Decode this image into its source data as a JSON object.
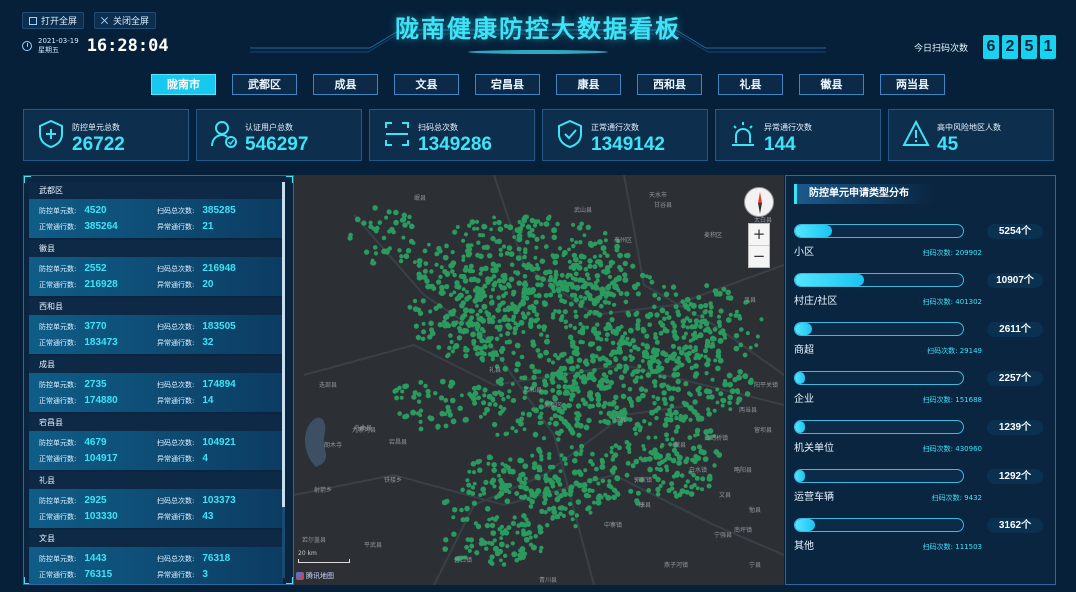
{
  "header": {
    "open_fullscreen": "打开全屏",
    "close_fullscreen": "关闭全屏",
    "date": "2021-03-19",
    "weekday": "星期五",
    "time": "16:28:04",
    "title": "陇南健康防控大数据看板",
    "scan_today_label": "今日扫码次数",
    "scan_today_digits": [
      "6",
      "2",
      "5",
      "1"
    ]
  },
  "tabs": [
    "陇南市",
    "武都区",
    "成县",
    "文县",
    "宕昌县",
    "康县",
    "西和县",
    "礼县",
    "徽县",
    "两当县"
  ],
  "stats": [
    {
      "label": "防控单元总数",
      "value": "26722",
      "icon": "shield-plus-icon"
    },
    {
      "label": "认证用户总数",
      "value": "546297",
      "icon": "user-check-icon"
    },
    {
      "label": "扫码总次数",
      "value": "1349286",
      "icon": "scan-icon"
    },
    {
      "label": "正常通行次数",
      "value": "1349142",
      "icon": "shield-check-icon"
    },
    {
      "label": "异常通行次数",
      "value": "144",
      "icon": "alarm-light-icon"
    },
    {
      "label": "高中风险地区人数",
      "value": "45",
      "icon": "warning-icon"
    }
  ],
  "region_labels": {
    "units": "防控单元数:",
    "scans": "扫码总次数:",
    "normal": "正常通行数:",
    "abnormal": "异常通行数:"
  },
  "regions": [
    {
      "name": "武都区",
      "units": "4520",
      "scans": "385285",
      "normal": "385264",
      "abnormal": "21"
    },
    {
      "name": "徽县",
      "units": "2552",
      "scans": "216948",
      "normal": "216928",
      "abnormal": "20"
    },
    {
      "name": "西和县",
      "units": "3770",
      "scans": "183505",
      "normal": "183473",
      "abnormal": "32"
    },
    {
      "name": "成县",
      "units": "2735",
      "scans": "174894",
      "normal": "174880",
      "abnormal": "14"
    },
    {
      "name": "宕昌县",
      "units": "4679",
      "scans": "104921",
      "normal": "104917",
      "abnormal": "4"
    },
    {
      "name": "礼县",
      "units": "2925",
      "scans": "103373",
      "normal": "103330",
      "abnormal": "43"
    },
    {
      "name": "文县",
      "units": "1443",
      "scans": "76318",
      "normal": "76315",
      "abnormal": "3"
    }
  ],
  "map": {
    "labels": [
      "岷县",
      "舟曲县",
      "迭部县",
      "宕昌县",
      "武山县",
      "甘谷县",
      "礼县",
      "西和县",
      "成县",
      "徽县",
      "两当县",
      "武都区",
      "康县",
      "文县",
      "九寨沟县",
      "平武县",
      "青川县",
      "宁强县",
      "略阳县",
      "勉县",
      "太白县",
      "凤县",
      "天水市",
      "麦积区",
      "秦州区",
      "留坝县",
      "阳平关镇",
      "白水镇",
      "南坪镇",
      "碧口镇",
      "射箭乡",
      "朗木寺",
      "若尔盖县",
      "铁楼乡",
      "中寨镇",
      "白鹤桥镇",
      "郭家镇",
      "燕子河镇",
      "宁县"
    ],
    "scale": "20 km",
    "logo": "腾讯地图"
  },
  "distribution": {
    "title": "防控单元申请类型分布",
    "scan_label": "扫码次数:",
    "items": [
      {
        "name": "小区",
        "count": "5254个",
        "scans": "209902",
        "ratio": 0.22
      },
      {
        "name": "村庄/社区",
        "count": "10907个",
        "scans": "401302",
        "ratio": 0.41
      },
      {
        "name": "商超",
        "count": "2611个",
        "scans": "29149",
        "ratio": 0.1
      },
      {
        "name": "企业",
        "count": "2257个",
        "scans": "151688",
        "ratio": 0.06
      },
      {
        "name": "机关单位",
        "count": "1239个",
        "scans": "430960",
        "ratio": 0.05
      },
      {
        "name": "运营车辆",
        "count": "1292个",
        "scans": "9432",
        "ratio": 0.06
      },
      {
        "name": "其他",
        "count": "3162个",
        "scans": "111503",
        "ratio": 0.12
      }
    ]
  },
  "colors": {
    "accent": "#3de4f7",
    "dot": "#2a9a5e",
    "background": "#06203a"
  }
}
